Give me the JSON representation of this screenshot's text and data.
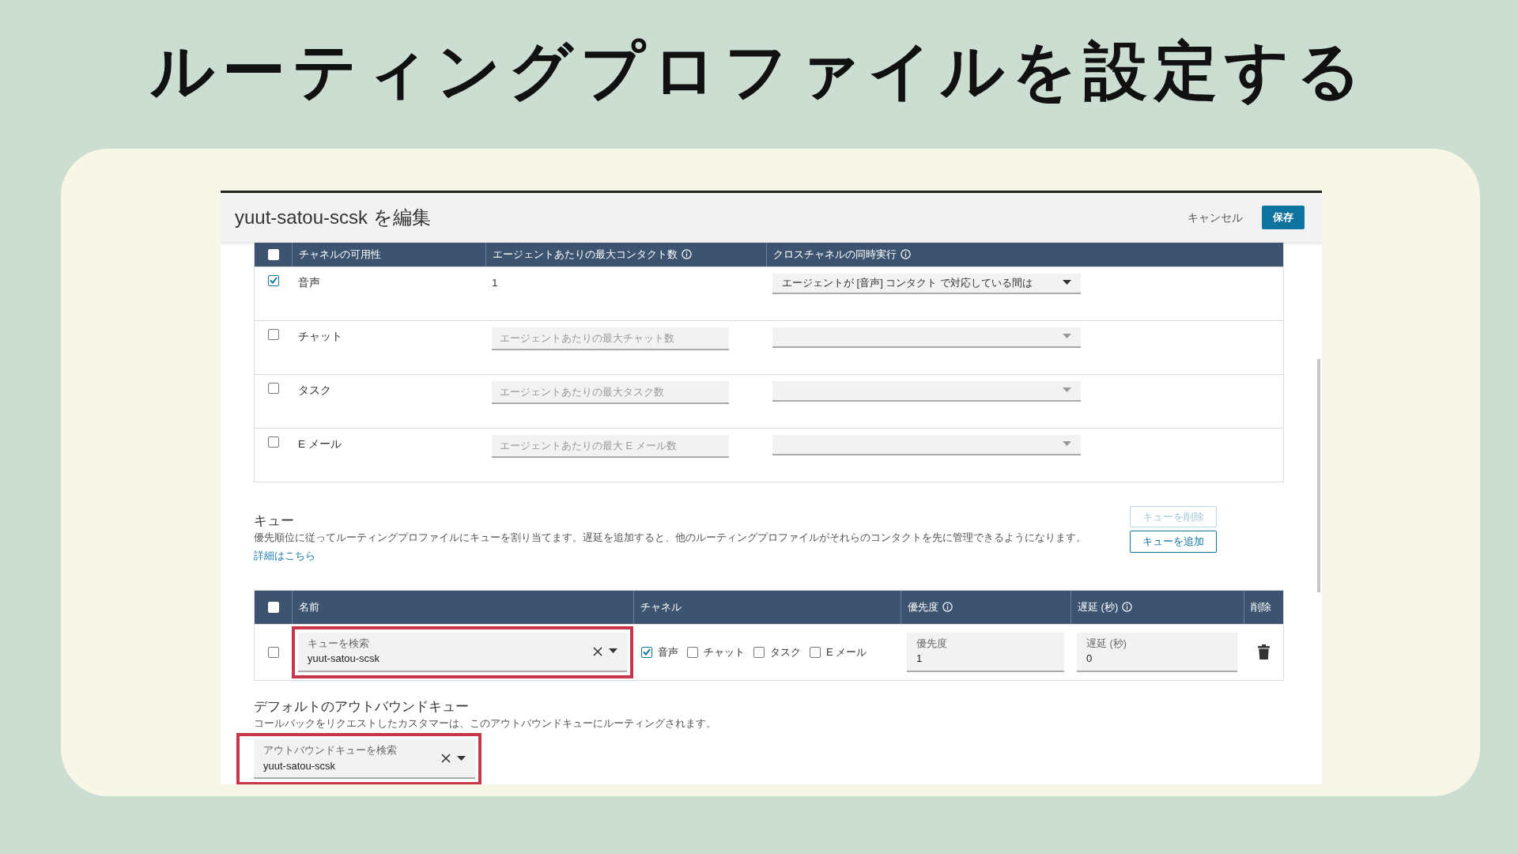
{
  "slide_title": "ルーティングプロファイルを設定する",
  "window": {
    "title": "yuut-satou-scsk を編集",
    "buttons": [
      {
        "label": "キャンセル",
        "kind": "link"
      },
      {
        "label": "保存",
        "kind": "primary"
      }
    ]
  },
  "channels": {
    "select_all_checked": false,
    "columns": [
      {
        "label": "チャネルの可用性",
        "info": false
      },
      {
        "label": "エージェントあたりの最大コンタクト数",
        "info": true
      },
      {
        "label": "クロスチャネルの同時実行",
        "info": true
      }
    ],
    "rows": [
      {
        "name": "音声",
        "checked": true,
        "max_contacts": "1",
        "cross_channel": "エージェントが [音声] コンタクト で対応している間は"
      },
      {
        "name": "チャット",
        "checked": false,
        "placeholder": "エージェントあたりの最大チャット数"
      },
      {
        "name": "タスク",
        "checked": false,
        "placeholder": "エージェントあたりの最大タスク数"
      },
      {
        "name": "E メール",
        "checked": false,
        "placeholder": "エージェントあたりの最大 E メール数"
      }
    ]
  },
  "queues": {
    "title": "キュー",
    "description": "優先順位に従ってルーティングプロファイルにキューを割り当てます。遅延を追加すると、他のルーティングプロファイルがそれらのコンタクトを先に管理できるようになります。",
    "link": "詳細はこちら",
    "buttons": [
      {
        "label": "キューを削除",
        "disabled": true
      },
      {
        "label": "キューを追加",
        "disabled": false
      }
    ],
    "select_all_checked": false,
    "columns": [
      {
        "label": "名前",
        "info": false
      },
      {
        "label": "チャネル",
        "info": false
      },
      {
        "label": "優先度",
        "info": true
      },
      {
        "label": "遅延 (秒)",
        "info": true
      },
      {
        "label": "削除",
        "info": false
      }
    ],
    "rows": [
      {
        "checked": false,
        "search_label": "キューを検索",
        "value": "yuut-satou-scsk",
        "highlighted": true,
        "channels": [
          {
            "label": "音声",
            "checked": true
          },
          {
            "label": "チャット",
            "checked": false
          },
          {
            "label": "タスク",
            "checked": false
          },
          {
            "label": "E メール",
            "checked": false
          }
        ],
        "priority_label": "優先度",
        "priority": "1",
        "delay_label": "遅延 (秒)",
        "delay": "0"
      }
    ]
  },
  "outbound": {
    "title": "デフォルトのアウトバウンドキュー",
    "description": "コールバックをリクエストしたカスタマーは、このアウトバウンドキューにルーティングされます。",
    "field_label": "アウトバウンドキューを検索",
    "value": "yuut-satou-scsk",
    "highlighted": true
  }
}
